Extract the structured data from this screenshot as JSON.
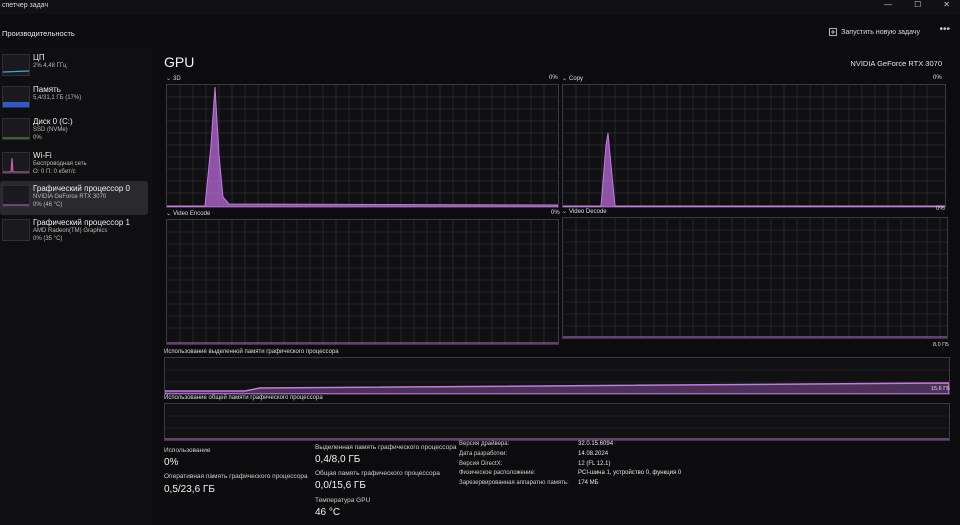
{
  "titlebar": {
    "title": "спетчер задач"
  },
  "header": {
    "page_title": "Производительность",
    "run_task_label": "Запустить новую задачу",
    "more_label": "•••"
  },
  "sidebar": {
    "items": [
      {
        "name": "ЦП",
        "line1": "2% 4,48 ГГц",
        "line2": ""
      },
      {
        "name": "Память",
        "line1": "5,4/31,1 ГБ (17%)",
        "line2": ""
      },
      {
        "name": "Диск 0 (C:)",
        "line1": "SSD (NVMe)",
        "line2": "0%"
      },
      {
        "name": "Wi-Fi",
        "line1": "Беспроводная сеть",
        "line2": "О: 0 П: 0 кбит/с"
      },
      {
        "name": "Графический процессор 0",
        "line1": "NVIDIA GeForce RTX 3070",
        "line2": "0% (46 °C)"
      },
      {
        "name": "Графический процессор 1",
        "line1": "AMD Radeon(TM) Graphics",
        "line2": "0% (35 °C)"
      }
    ]
  },
  "main": {
    "title": "GPU",
    "model": "NVIDIA GeForce RTX 3070",
    "engines": [
      {
        "label": "3D",
        "percent": "0%"
      },
      {
        "label": "Copy",
        "percent": "0%"
      },
      {
        "label": "Video Encode",
        "percent": "0%"
      },
      {
        "label": "Video Decode",
        "percent": "0%"
      }
    ],
    "dedicated_memory": {
      "label": "Использование выделенной памяти графического процессора",
      "max": "8,0 ГБ"
    },
    "shared_memory": {
      "label": "Использование общей памяти графического процессора",
      "max": "15,6 ГБ"
    }
  },
  "stats": {
    "utilization_label": "Использование",
    "utilization_value": "0%",
    "gpu_memory_label": "Оперативная память графического процессора",
    "gpu_memory_value": "0,5/23,6 ГБ",
    "dedicated_label": "Выделенная память графического процессора",
    "dedicated_value": "0,4/8,0 ГБ",
    "shared_label": "Общая память графического процессора",
    "shared_value": "0,0/15,6 ГБ",
    "temp_label": "Температура GPU",
    "temp_value": "46 °C"
  },
  "properties": [
    {
      "key": "Версия драйвера:",
      "value": "32.0.15.6094"
    },
    {
      "key": "Дата разработки:",
      "value": "14.08.2024"
    },
    {
      "key": "Версия DirectX:",
      "value": "12 (FL 12.1)"
    },
    {
      "key": "Физическое расположение:",
      "value": "PCI-шина 1, устройство 0, функция 0"
    },
    {
      "key": "Зарезервированная аппаратно память:",
      "value": "174 МБ"
    }
  ],
  "colors": {
    "accent": "#b86ad8",
    "grid": "#2c2c32",
    "background": "#0c0c0e"
  }
}
